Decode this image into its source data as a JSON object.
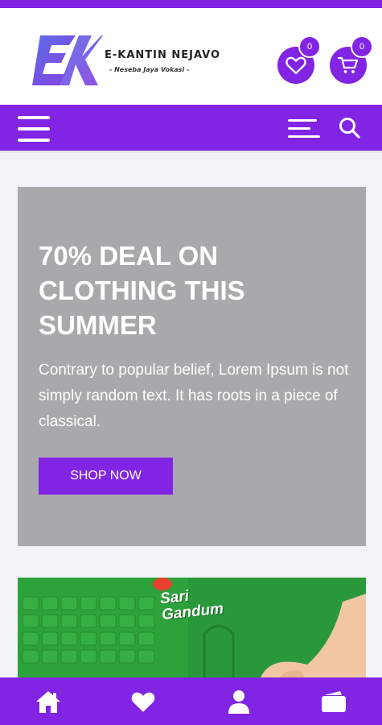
{
  "header": {
    "brand_name": "E-KANTIN NEJAVO",
    "brand_tagline": "- Neseba Jaya Vokasi -",
    "wishlist_count": "0",
    "cart_count": "0"
  },
  "icons": {
    "menu": "hamburger-icon",
    "category_menu": "lines-icon",
    "search": "search-icon",
    "wishlist": "heart-icon",
    "cart": "cart-icon",
    "home": "home-icon",
    "favorites": "heart-icon",
    "account": "user-icon",
    "wallet": "wallet-icon"
  },
  "hero": {
    "title": "70% DEAL ON CLOTHING THIS SUMMER",
    "description": "Contrary to popular belief, Lorem Ipsum is not simply random text. It has roots in a piece of classical.",
    "button_label": "SHOP NOW"
  },
  "banner": {
    "product_text": "Sari Gandum"
  },
  "colors": {
    "accent": "#8224e3",
    "hero_bg": "#a9a9ab",
    "banner_bg": "#2da23a",
    "page_bg": "#f1f3f8"
  }
}
